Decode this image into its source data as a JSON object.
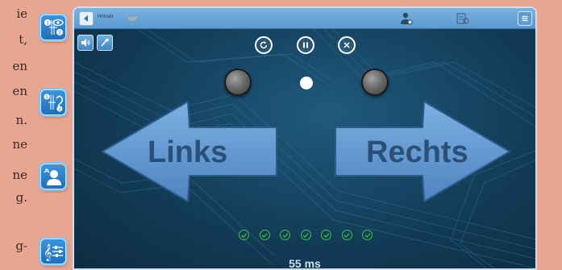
{
  "left_text_fragments": [
    "ie",
    "t,",
    "en",
    "en",
    "n.",
    "ne",
    "ne",
    "g.",
    "g-"
  ],
  "tiles": [
    {
      "name": "eye-notes-tile",
      "icon": "eye-notes-icon"
    },
    {
      "name": "ear-notes-tile",
      "icon": "ear-notes-icon"
    },
    {
      "name": "listener-tile",
      "icon": "listener-icon"
    },
    {
      "name": "clef-sliders-tile",
      "icon": "clef-sliders-icon"
    }
  ],
  "app": {
    "title": "Hörtakt",
    "back_icon": "back-arrow-icon",
    "bird_icon": "bird-icon",
    "user_icon": "user-settings-icon",
    "info_icon": "info-icon",
    "menu_icon": "menu-icon",
    "speaker_icon": "speaker-icon",
    "mic_icon": "mic-icon",
    "controls": {
      "restart_icon": "restart-icon",
      "pause_icon": "pause-icon",
      "close_icon": "close-icon"
    },
    "left_arrow_label": "Links",
    "right_arrow_label": "Rechts",
    "checks_count": 7,
    "timing_label": "55 ms",
    "colors": {
      "arrow_fill": "#5a90cc",
      "arrow_text": "#2a4f78",
      "check": "#3fc23f",
      "background": "#17425f"
    }
  }
}
